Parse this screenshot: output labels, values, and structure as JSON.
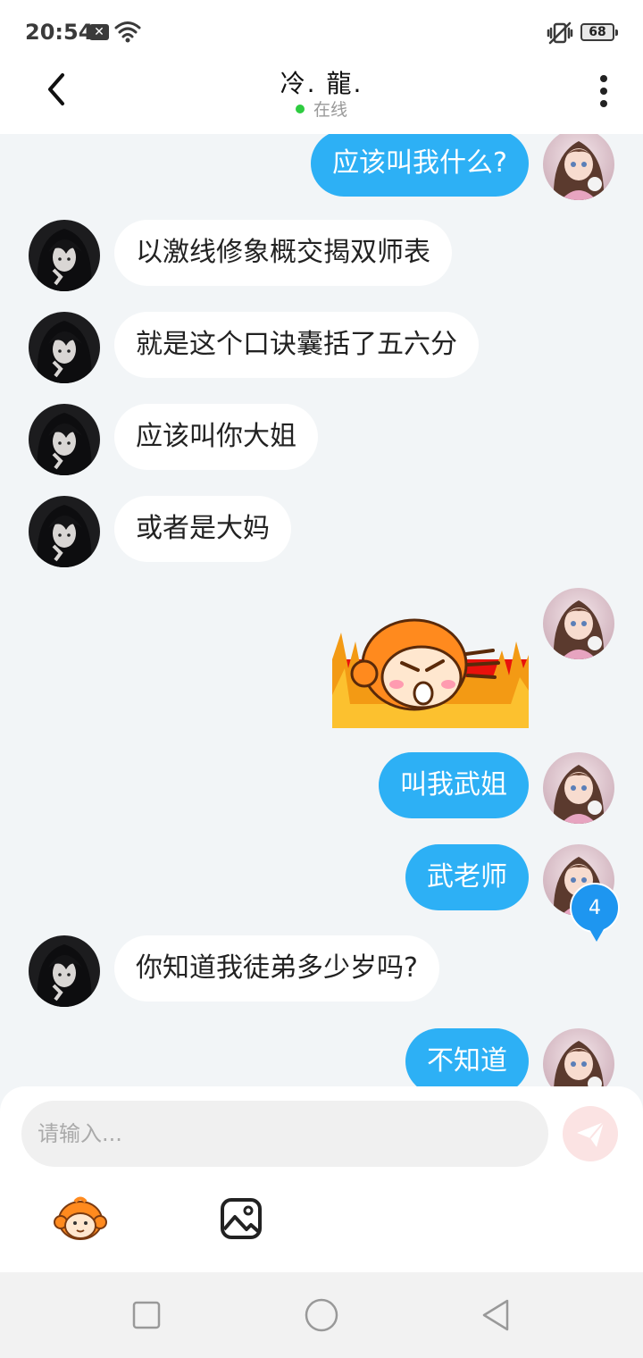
{
  "status_bar": {
    "time": "20:54",
    "notification_icon": "close-x-icon",
    "wifi_icon": "wifi-icon",
    "vibrate_icon": "vibrate-icon",
    "battery": "68"
  },
  "header": {
    "back_icon": "chevron-left-icon",
    "title": "冷. 龍.",
    "status": "在线",
    "status_color": "#2ecc40",
    "more_icon": "more-vertical-icon"
  },
  "messages": [
    {
      "side": "out",
      "type": "text",
      "text": "应该叫我什么?"
    },
    {
      "side": "in",
      "type": "text",
      "text": "以激线修象概交揭双师表"
    },
    {
      "side": "in",
      "type": "text",
      "text": "就是这个口诀囊括了五六分"
    },
    {
      "side": "in",
      "type": "text",
      "text": "应该叫你大姐"
    },
    {
      "side": "in",
      "type": "text",
      "text": "或者是大妈"
    },
    {
      "side": "out",
      "type": "sticker",
      "sticker": "angry-monkey-sticker"
    },
    {
      "side": "out",
      "type": "text",
      "text": "叫我武姐"
    },
    {
      "side": "out",
      "type": "text",
      "text": "武老师"
    },
    {
      "side": "in",
      "type": "text",
      "text": "你知道我徒弟多少岁吗?"
    },
    {
      "side": "out",
      "type": "text",
      "text": "不知道"
    }
  ],
  "unread_badge": "4",
  "composer": {
    "placeholder": "请输入...",
    "send_icon": "paper-plane-icon",
    "emoji_icon": "monkey-emoji-icon",
    "image_icon": "image-icon"
  },
  "colors": {
    "outgoing_bubble": "#2db0f5",
    "incoming_bubble": "#ffffff",
    "background": "#f2f5f7",
    "badge": "#1e96f0"
  },
  "nav": {
    "recents_icon": "square-icon",
    "home_icon": "circle-icon",
    "back_icon": "triangle-back-icon"
  }
}
